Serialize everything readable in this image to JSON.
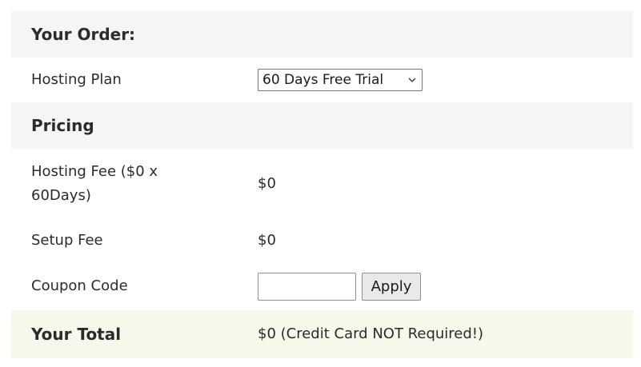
{
  "order": {
    "title": "Your Order:",
    "hosting_plan_label": "Hosting Plan",
    "hosting_plan_value": "60 Days Free Trial"
  },
  "pricing": {
    "title": "Pricing",
    "hosting_fee_label": "Hosting Fee ($0 x 60Days)",
    "hosting_fee_value": "$0",
    "setup_fee_label": "Setup Fee",
    "setup_fee_value": "$0",
    "coupon_label": "Coupon Code",
    "coupon_value": "",
    "apply_label": "Apply"
  },
  "total": {
    "label": "Your Total",
    "value": "$0 (Credit Card NOT Required!)"
  },
  "icons": {
    "select_arrow": "chevron-down-icon"
  },
  "colors": {
    "header_bg": "#f4f5f4",
    "total_bg": "#f7f8ec"
  }
}
